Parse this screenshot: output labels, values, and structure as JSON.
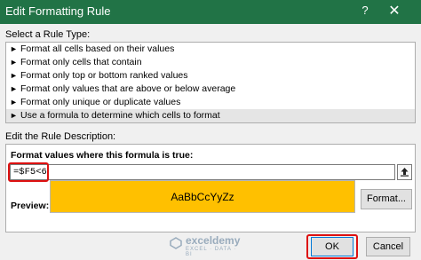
{
  "window": {
    "title": "Edit Formatting Rule",
    "help_glyph": "?",
    "close_glyph": "✕"
  },
  "rule_type": {
    "label": "Select a Rule Type:",
    "items": [
      {
        "label": "Format all cells based on their values"
      },
      {
        "label": "Format only cells that contain"
      },
      {
        "label": "Format only top or bottom ranked values"
      },
      {
        "label": "Format only values that are above or below average"
      },
      {
        "label": "Format only unique or duplicate values"
      },
      {
        "label": "Use a formula to determine which cells to format"
      }
    ],
    "selected_index": 5,
    "bullet": "►"
  },
  "description": {
    "label": "Edit the Rule Description:",
    "formula_label": "Format values where this formula is true:",
    "formula_value": "=$F5<6",
    "preview_label": "Preview:",
    "preview_text": "AaBbCcYyZz",
    "preview_fill": "#ffc000",
    "format_button": "Format..."
  },
  "buttons": {
    "ok": "OK",
    "cancel": "Cancel"
  },
  "watermark": {
    "name": "exceldemy",
    "tagline": "EXCEL · DATA · BI"
  },
  "colors": {
    "titlebar": "#217346",
    "highlight_outline": "#dd1111",
    "selected_row": "#e5e5e5"
  }
}
